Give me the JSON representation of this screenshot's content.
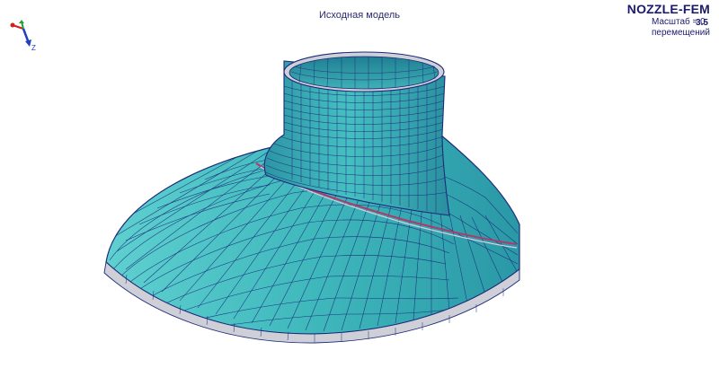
{
  "view": {
    "title": "Исходная модель"
  },
  "app": {
    "name": "NOZZLE-FEM",
    "version": "3.5"
  },
  "legend": {
    "scale_label": "Масштаб = 0",
    "displacements_label": "перемещений"
  },
  "axes": {
    "z_label": "Z"
  },
  "colors": {
    "mesh_fill": "#3fb8bc",
    "mesh_lines": "#1c2a7a",
    "rim": "#cfcfd8",
    "weld": "#b03a6a"
  }
}
